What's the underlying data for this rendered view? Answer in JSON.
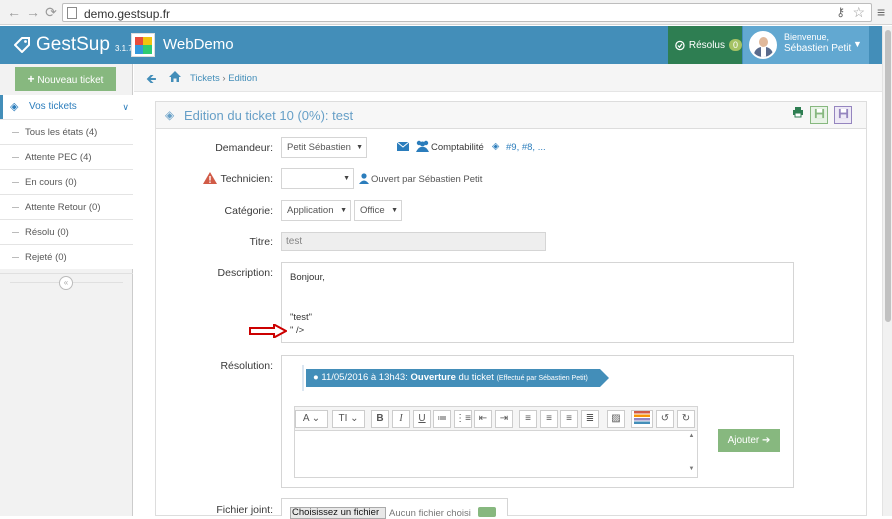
{
  "browser": {
    "url": "demo.gestsup.fr"
  },
  "app": {
    "name": "GestSup",
    "version": "3.1.7",
    "instance": "WebDemo"
  },
  "header": {
    "resolus_label": "Résolus",
    "resolus_count": "0",
    "welcome": "Bienvenue,",
    "user": "Sébastien Petit"
  },
  "sidebar": {
    "new_ticket": "Nouveau ticket",
    "section": "Vos tickets",
    "items": [
      {
        "label": "Tous les états (4)"
      },
      {
        "label": "Attente PEC (4)"
      },
      {
        "label": "En cours (0)"
      },
      {
        "label": "Attente Retour (0)"
      },
      {
        "label": "Résolu (0)"
      },
      {
        "label": "Rejeté (0)"
      }
    ]
  },
  "breadcrumb": {
    "tickets": "Tickets",
    "sep": " › ",
    "current": "Edition"
  },
  "panel": {
    "title": "Edition du ticket 10 (0%): test"
  },
  "form": {
    "demandeur_label": "Demandeur:",
    "demandeur_value": "Petit Sébastien",
    "service": "Comptabilité",
    "tickets_links": "#9, #8, ...",
    "technicien_label": "Technicien:",
    "technicien_value": "",
    "opened_by": "Ouvert par Sébastien Petit",
    "categorie_label": "Catégorie:",
    "categorie_value": "Application",
    "subcategorie_value": "Office",
    "titre_label": "Titre:",
    "titre_value": "test",
    "description_label": "Description:",
    "description_lines": [
      "Bonjour,",
      "\"test\"",
      "\" />"
    ],
    "resolution_label": "Résolution:",
    "timeline_date": "11/05/2016 à 13h43:",
    "timeline_event": "Ouverture",
    "timeline_suffix": "du ticket",
    "timeline_author": "(Effectué par Sébastien Petit)",
    "ajouter_label": "Ajouter",
    "fichier_label": "Fichier joint:",
    "file_button": "Choisissez un fichier",
    "file_none": "Aucun fichier choisi"
  },
  "colors": {
    "primary": "#438eb9",
    "green": "#87b87f",
    "dark_green": "#2e7e52",
    "purple": "#9585bf"
  }
}
